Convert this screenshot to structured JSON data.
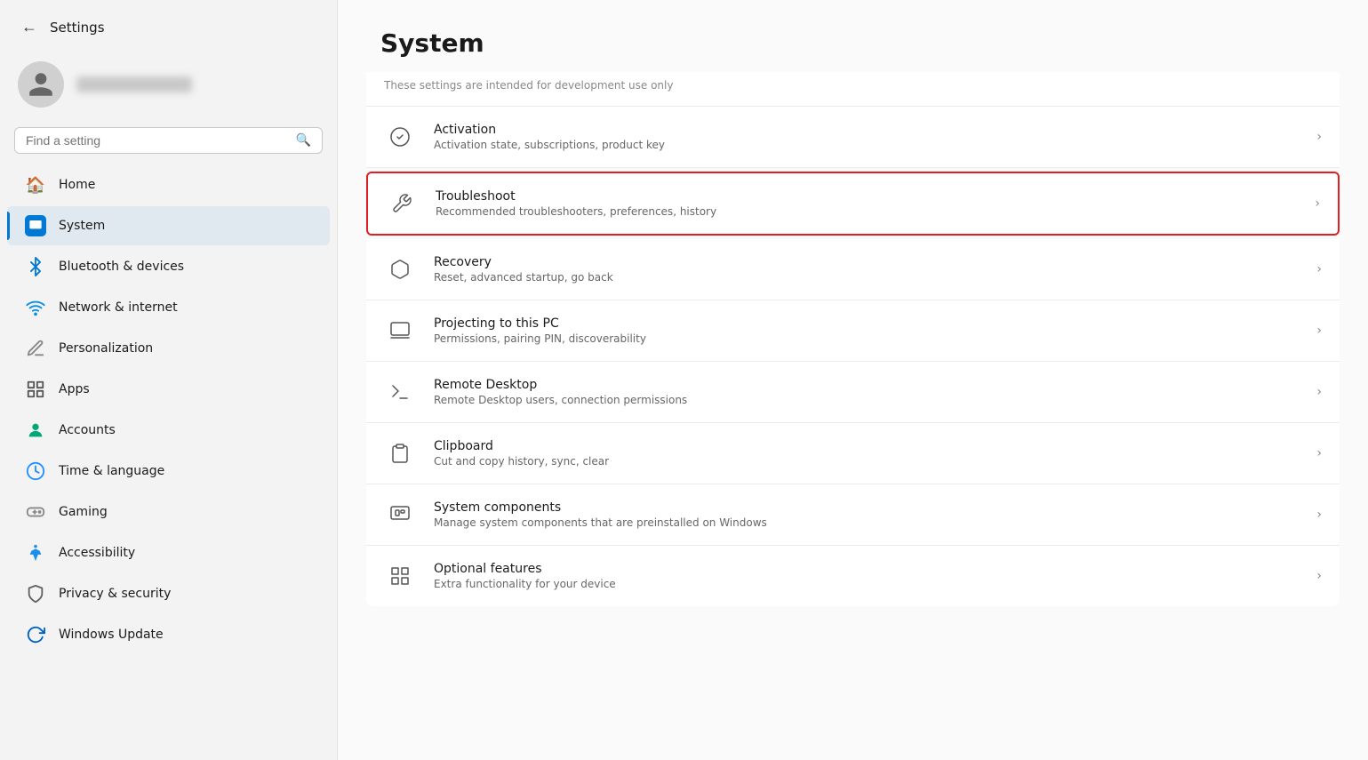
{
  "app": {
    "title": "Settings",
    "back_label": "←"
  },
  "search": {
    "placeholder": "Find a setting"
  },
  "nav": {
    "items": [
      {
        "id": "home",
        "label": "Home",
        "icon": "home"
      },
      {
        "id": "system",
        "label": "System",
        "icon": "system",
        "active": true
      },
      {
        "id": "bluetooth",
        "label": "Bluetooth & devices",
        "icon": "bluetooth"
      },
      {
        "id": "network",
        "label": "Network & internet",
        "icon": "network"
      },
      {
        "id": "personalization",
        "label": "Personalization",
        "icon": "personalization"
      },
      {
        "id": "apps",
        "label": "Apps",
        "icon": "apps"
      },
      {
        "id": "accounts",
        "label": "Accounts",
        "icon": "accounts"
      },
      {
        "id": "time",
        "label": "Time & language",
        "icon": "time"
      },
      {
        "id": "gaming",
        "label": "Gaming",
        "icon": "gaming"
      },
      {
        "id": "accessibility",
        "label": "Accessibility",
        "icon": "accessibility"
      },
      {
        "id": "privacy",
        "label": "Privacy & security",
        "icon": "privacy"
      },
      {
        "id": "update",
        "label": "Windows Update",
        "icon": "update"
      }
    ]
  },
  "main": {
    "page_title": "System",
    "dev_note": "These settings are intended for development use only",
    "settings": [
      {
        "id": "activation",
        "title": "Activation",
        "desc": "Activation state, subscriptions, product key",
        "highlighted": false
      },
      {
        "id": "troubleshoot",
        "title": "Troubleshoot",
        "desc": "Recommended troubleshooters, preferences, history",
        "highlighted": true
      },
      {
        "id": "recovery",
        "title": "Recovery",
        "desc": "Reset, advanced startup, go back",
        "highlighted": false
      },
      {
        "id": "projecting",
        "title": "Projecting to this PC",
        "desc": "Permissions, pairing PIN, discoverability",
        "highlighted": false
      },
      {
        "id": "remote-desktop",
        "title": "Remote Desktop",
        "desc": "Remote Desktop users, connection permissions",
        "highlighted": false
      },
      {
        "id": "clipboard",
        "title": "Clipboard",
        "desc": "Cut and copy history, sync, clear",
        "highlighted": false
      },
      {
        "id": "system-components",
        "title": "System components",
        "desc": "Manage system components that are preinstalled on Windows",
        "highlighted": false
      },
      {
        "id": "optional-features",
        "title": "Optional features",
        "desc": "Extra functionality for your device",
        "highlighted": false
      }
    ]
  }
}
